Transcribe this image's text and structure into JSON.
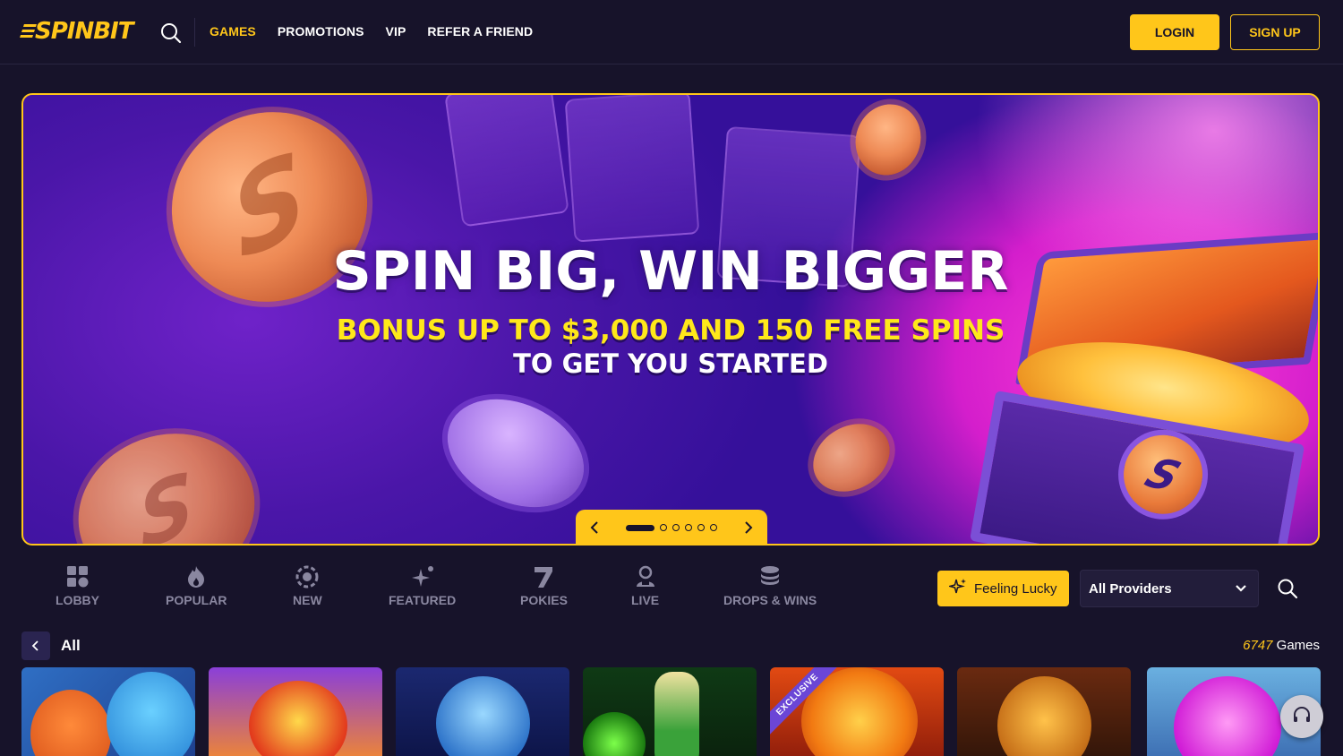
{
  "brand": {
    "logo_text": "SPINBIT",
    "accent": "#ffc61a",
    "background": "#17132a"
  },
  "header": {
    "nav": [
      {
        "label": "GAMES",
        "active": true
      },
      {
        "label": "PROMOTIONS",
        "active": false
      },
      {
        "label": "VIP",
        "active": false
      },
      {
        "label": "REFER A FRIEND",
        "active": false
      }
    ],
    "login_label": "LOGIN",
    "signup_label": "SIGN UP",
    "search_icon": "search-icon"
  },
  "hero": {
    "title": "SPIN BIG, WIN BIGGER",
    "subtitle": "BONUS UP TO $3,000 AND 150 FREE SPINS",
    "subtitle2": "TO GET YOU STARTED",
    "slide_count": 6,
    "active_slide": 1
  },
  "categories": [
    {
      "label": "LOBBY",
      "icon": "grid-icon"
    },
    {
      "label": "POPULAR",
      "icon": "flame-icon"
    },
    {
      "label": "NEW",
      "icon": "chip-icon"
    },
    {
      "label": "FEATURED",
      "icon": "sparkle-icon"
    },
    {
      "label": "POKIES",
      "icon": "seven-icon"
    },
    {
      "label": "LIVE",
      "icon": "dealer-icon"
    },
    {
      "label": "DROPS & WINS",
      "icon": "coin-stack-icon"
    }
  ],
  "filters": {
    "feeling_lucky_label": "Feeling Lucky",
    "provider_selected": "All Providers"
  },
  "games_section": {
    "title": "All",
    "count": "6747",
    "count_suffix": " Games",
    "tiles": [
      {
        "name": "fox-and-wolf",
        "badge": ""
      },
      {
        "name": "lion-dance",
        "badge": ""
      },
      {
        "name": "blue-bear",
        "badge": ""
      },
      {
        "name": "green-pharaoh",
        "badge": ""
      },
      {
        "name": "fire-lion",
        "badge": "EXCLUSIVE"
      },
      {
        "name": "golden-buffalo",
        "badge": ""
      },
      {
        "name": "pink-bear",
        "badge": ""
      }
    ]
  }
}
